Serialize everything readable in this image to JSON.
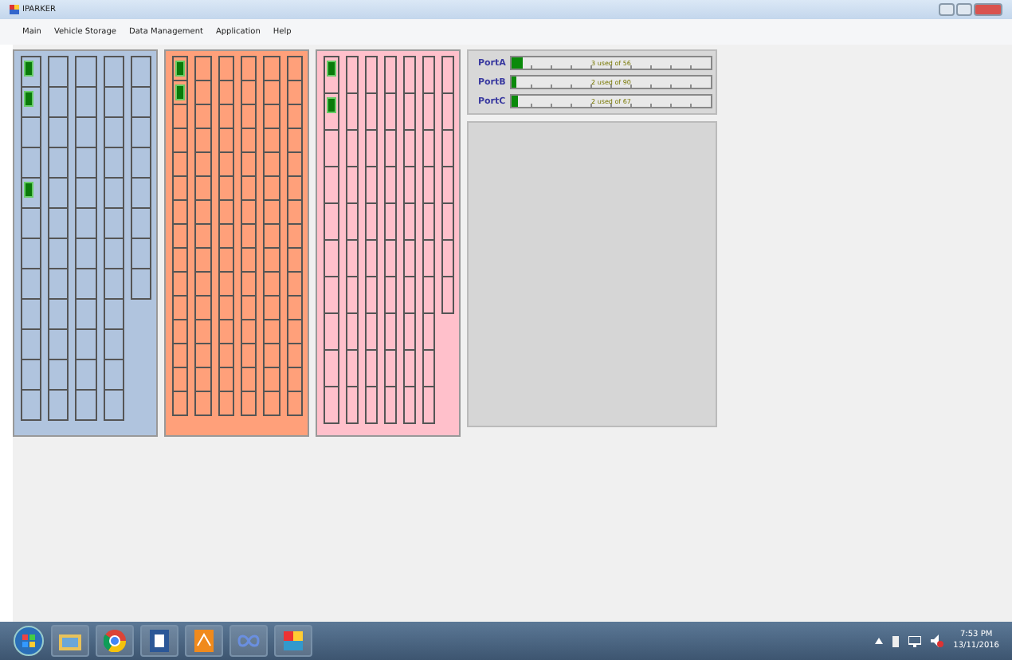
{
  "window": {
    "title": "IPARKER"
  },
  "menu": [
    "Main",
    "Vehicle Storage",
    "Data Management",
    "Application",
    "Help"
  ],
  "zones": [
    {
      "color": "#b0c4de",
      "columns": [
        {
          "slots": [
            true,
            true,
            false,
            false,
            true,
            false,
            false,
            false,
            false,
            false,
            false,
            false
          ]
        },
        {
          "slots": [
            false,
            false,
            false,
            false,
            false,
            false,
            false,
            false,
            false,
            false,
            false,
            false
          ]
        },
        {
          "slots": [
            false,
            false,
            false,
            false,
            false,
            false,
            false,
            false,
            false,
            false,
            false,
            false
          ]
        },
        {
          "slots": [
            false,
            false,
            false,
            false,
            false,
            false,
            false,
            false,
            false,
            false,
            false,
            false
          ]
        },
        {
          "slots": [
            false,
            false,
            false,
            false,
            false,
            false,
            false,
            false
          ]
        }
      ]
    },
    {
      "color": "#ffa07a",
      "columns": [
        {
          "slots": [
            true,
            true,
            false,
            false,
            false,
            false,
            false,
            false,
            false,
            false,
            false,
            false,
            false,
            false,
            false
          ]
        },
        {
          "slots": [
            false,
            false,
            false,
            false,
            false,
            false,
            false,
            false,
            false,
            false,
            false,
            false,
            false,
            false,
            false
          ]
        },
        {
          "slots": [
            false,
            false,
            false,
            false,
            false,
            false,
            false,
            false,
            false,
            false,
            false,
            false,
            false,
            false,
            false
          ]
        },
        {
          "slots": [
            false,
            false,
            false,
            false,
            false,
            false,
            false,
            false,
            false,
            false,
            false,
            false,
            false,
            false,
            false
          ]
        },
        {
          "slots": [
            false,
            false,
            false,
            false,
            false,
            false,
            false,
            false,
            false,
            false,
            false,
            false,
            false,
            false,
            false
          ]
        },
        {
          "slots": [
            false,
            false,
            false,
            false,
            false,
            false,
            false,
            false,
            false,
            false,
            false,
            false,
            false,
            false,
            false
          ]
        }
      ]
    },
    {
      "color": "#ffc0cb",
      "columns": [
        {
          "slots": [
            true,
            true,
            false,
            false,
            false,
            false,
            false,
            false,
            false,
            false
          ]
        },
        {
          "slots": [
            false,
            false,
            false,
            false,
            false,
            false,
            false,
            false,
            false,
            false
          ]
        },
        {
          "slots": [
            false,
            false,
            false,
            false,
            false,
            false,
            false,
            false,
            false,
            false
          ]
        },
        {
          "slots": [
            false,
            false,
            false,
            false,
            false,
            false,
            false,
            false,
            false,
            false
          ]
        },
        {
          "slots": [
            false,
            false,
            false,
            false,
            false,
            false,
            false,
            false,
            false,
            false
          ]
        },
        {
          "slots": [
            false,
            false,
            false,
            false,
            false,
            false,
            false,
            false,
            false,
            false
          ]
        },
        {
          "slots": [
            false,
            false,
            false,
            false,
            false,
            false,
            false
          ]
        }
      ]
    }
  ],
  "ports": [
    {
      "name": "PortA",
      "level": 0.054,
      "reading": "3 used of 56"
    },
    {
      "name": "PortB",
      "level": 0.022,
      "reading": "2 used of 90"
    },
    {
      "name": "PortC",
      "level": 0.03,
      "reading": "2 used of 67"
    }
  ],
  "taskbar": {
    "time": "7:53 PM",
    "date": "13/11/2016"
  }
}
